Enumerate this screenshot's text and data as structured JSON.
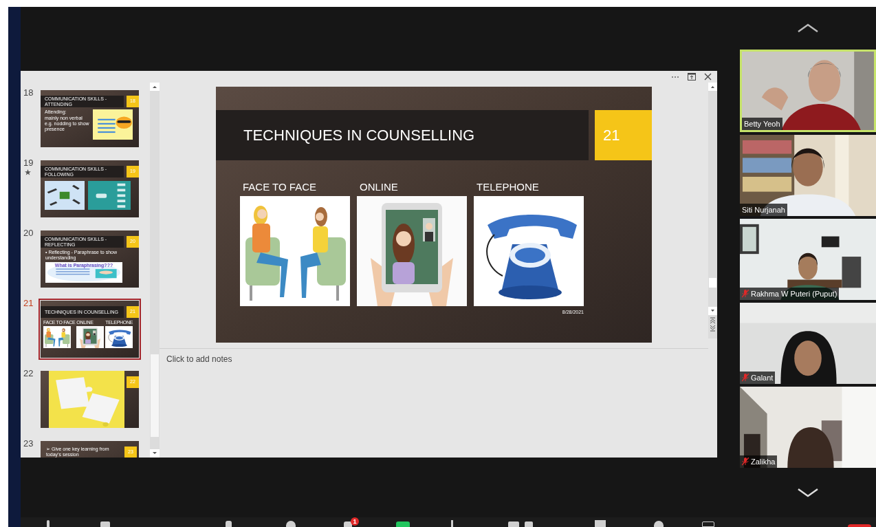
{
  "slides_pane": {
    "thumbnails": [
      {
        "number": "18",
        "selected": false,
        "animated": false,
        "kind": "text_picture",
        "title": "COMMUNICATION SKILLS - ATTENDING",
        "badge": "18",
        "lines": [
          "Attending:",
          "mainly non verbal e.g. nodding to show presence"
        ]
      },
      {
        "number": "19",
        "selected": false,
        "animated": true,
        "kind": "two_pictures",
        "title": "COMMUNICATION SKILLS - FOLLOWING",
        "badge": "19"
      },
      {
        "number": "20",
        "selected": false,
        "animated": false,
        "kind": "bullet_picture",
        "title": "COMMUNICATION SKILLS - REFLECTING",
        "badge": "20",
        "lines": [
          "• Reflecting - Paraphrase to show understanding",
          "What is Paraphrasing???"
        ]
      },
      {
        "number": "21",
        "selected": true,
        "animated": false,
        "kind": "three_pictures",
        "title": "TECHNIQUES IN COUNSELLING",
        "badge": "21",
        "lines": [
          "FACE TO FACE",
          "ONLINE",
          "TELEPHONE"
        ]
      },
      {
        "number": "22",
        "selected": false,
        "animated": false,
        "kind": "picture",
        "badge": "22"
      },
      {
        "number": "23",
        "selected": false,
        "animated": false,
        "kind": "bullet",
        "title": "➢ Give one key learning from today's session",
        "badge": "23"
      }
    ]
  },
  "slide": {
    "title": "TECHNIQUES IN COUNSELLING",
    "number": "21",
    "columns": [
      {
        "heading": "FACE TO FACE",
        "kind": "people"
      },
      {
        "heading": "ONLINE",
        "kind": "tablet"
      },
      {
        "heading": "TELEPHONE",
        "kind": "phone"
      }
    ],
    "date": "8/28/2021"
  },
  "notes": {
    "placeholder": "Click to add notes"
  },
  "participants": [
    {
      "name": "Betty Yeoh",
      "speaking": true,
      "muted": false
    },
    {
      "name": "Siti Nurjanah",
      "speaking": false,
      "muted": false
    },
    {
      "name": "Rakhma W Puteri (Puput)",
      "speaking": false,
      "muted": true
    },
    {
      "name": "Galant",
      "speaking": false,
      "muted": true
    },
    {
      "name": "Zalikha",
      "speaking": false,
      "muted": true
    }
  ],
  "toolbar": {
    "chat_badge": "1"
  }
}
